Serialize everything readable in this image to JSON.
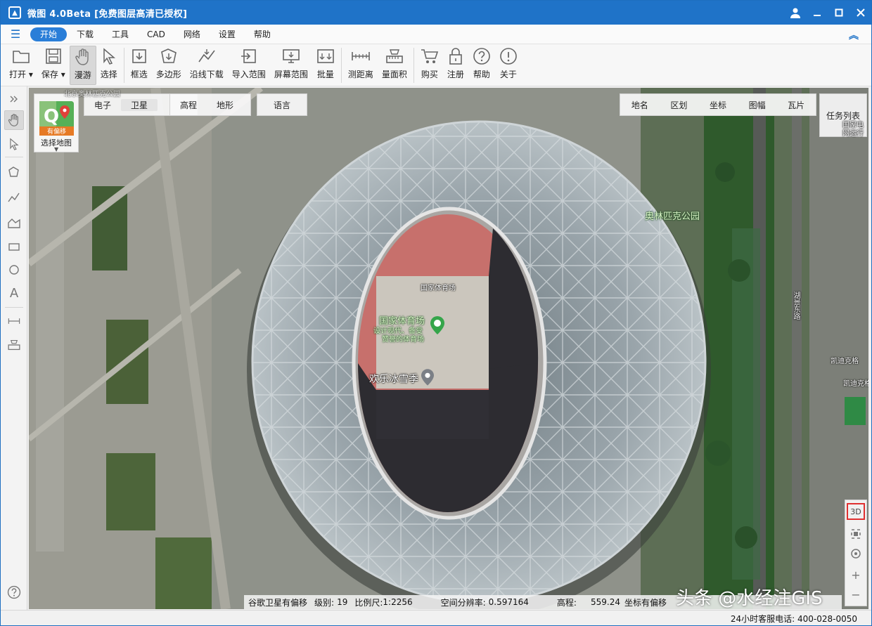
{
  "titlebar": {
    "title": "微图 4.0Beta [免费图层高清已授权]",
    "controls": [
      "user-icon",
      "minimize-icon",
      "maximize-icon",
      "close-icon"
    ]
  },
  "menu": {
    "items": [
      "开始",
      "下载",
      "工具",
      "CAD",
      "网络",
      "设置",
      "帮助"
    ],
    "active_index": 0
  },
  "toolbar": {
    "tools": [
      {
        "label": "打开",
        "icon": "folder-icon",
        "has_dropdown": true
      },
      {
        "label": "保存",
        "icon": "save-icon",
        "has_dropdown": true
      },
      {
        "label": "漫游",
        "icon": "hand-icon",
        "active": true
      },
      {
        "label": "选择",
        "icon": "cursor-icon"
      },
      {
        "label": "框选",
        "icon": "box-download-icon"
      },
      {
        "label": "多边形",
        "icon": "polygon-download-icon"
      },
      {
        "label": "沿线下载",
        "icon": "polyline-download-icon"
      },
      {
        "label": "导入范围",
        "icon": "import-range-icon"
      },
      {
        "label": "屏幕范围",
        "icon": "screen-range-icon"
      },
      {
        "label": "批量",
        "icon": "batch-icon"
      },
      {
        "label": "测距离",
        "icon": "ruler-icon"
      },
      {
        "label": "量面积",
        "icon": "area-icon"
      },
      {
        "label": "购买",
        "icon": "cart-icon"
      },
      {
        "label": "注册",
        "icon": "lock-icon"
      },
      {
        "label": "帮助",
        "icon": "help-icon"
      },
      {
        "label": "关于",
        "icon": "info-icon"
      }
    ]
  },
  "map": {
    "source_selector_label": "选择地图",
    "source_badge": "有偏移",
    "layer_tabs": [
      "电子",
      "卫星",
      "高程",
      "地形"
    ],
    "active_layer_index": 1,
    "language_button": "语言",
    "right_tabs": [
      "地名",
      "区划",
      "坐标",
      "图幅",
      "瓦片"
    ],
    "task_list_label": "任务列表",
    "labels": {
      "olympic_park": "奥林匹克公园",
      "stadium_small": "国家体育场",
      "stadium_name": "国家体育场",
      "stadium_desc1": "设计现代、备受",
      "stadium_desc2": "赞誉的体育场",
      "winter_event": "欢乐冰雪季",
      "road": "湖景东路",
      "topleft_faded": "北京奥林匹克公园",
      "right_faded1": "凯迪克格",
      "right_faded2": "凯迪克格",
      "right_faded3": "国家电",
      "right_faded4": "网运行"
    },
    "controls": {
      "threed_label": "3D",
      "buttons": [
        "fullextent-icon",
        "locate-icon",
        "zoom-in-icon",
        "zoom-out-icon"
      ]
    },
    "info_bar": {
      "source": "谷歌卫星有偏移",
      "level_label": "级别:",
      "level": "19",
      "scale_label": "比例尺:",
      "scale": "1:2256",
      "resolution_label": "空间分辨率:",
      "resolution": "0.597164",
      "elevation_label": "高程:",
      "elevation": "559.24",
      "coord_label": "坐标有偏移"
    },
    "watermark": "头条 @水经注GIS"
  },
  "statusbar": {
    "phone": "24小时客服电话: 400-028-0050"
  },
  "left_tools": [
    "expand-icon",
    "hand-icon",
    "cursor-icon",
    "polygon-icon",
    "polyline-icon",
    "area-icon",
    "rectangle-icon",
    "circle-icon",
    "text-icon",
    "ruler-icon",
    "area-measure-icon",
    "help-icon"
  ]
}
